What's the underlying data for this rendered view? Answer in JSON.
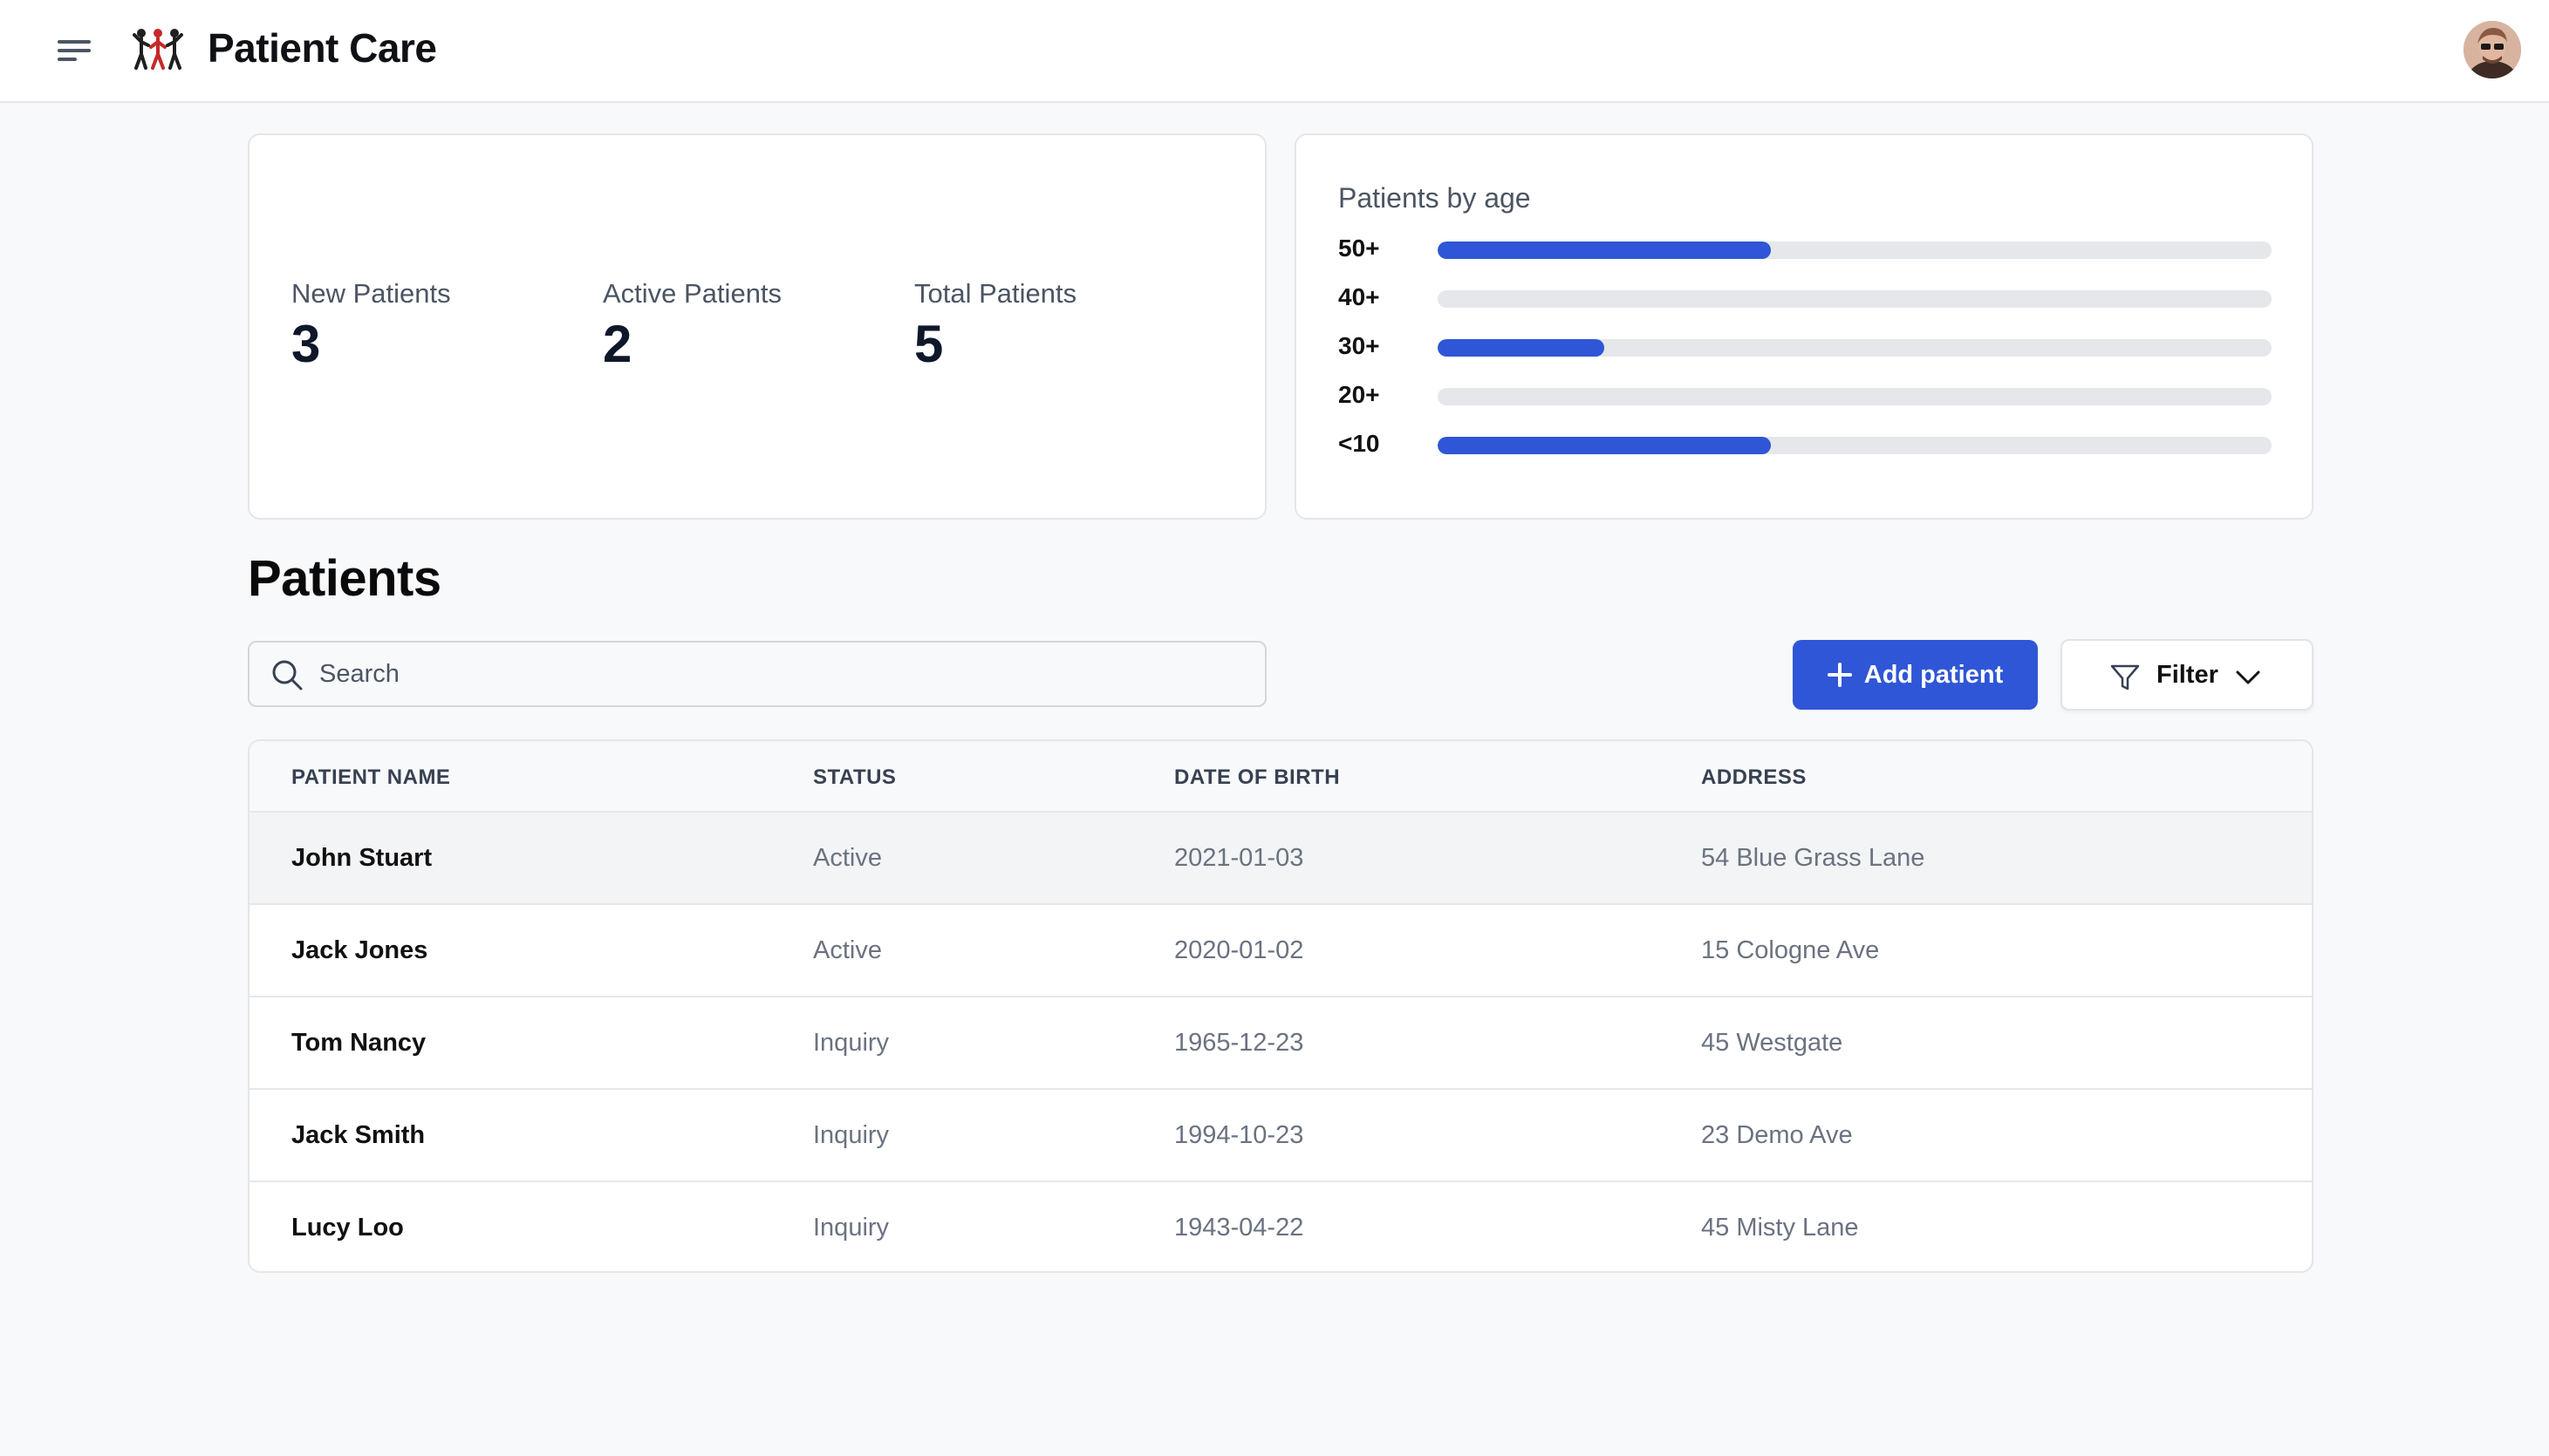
{
  "header": {
    "title": "Patient Care",
    "menu_icon": "hamburger-icon",
    "logo_icon": "people-group-icon",
    "avatar_icon": "user-avatar"
  },
  "stats": [
    {
      "label": "New Patients",
      "value": "3"
    },
    {
      "label": "Active Patients",
      "value": "2"
    },
    {
      "label": "Total Patients",
      "value": "5"
    }
  ],
  "age_chart": {
    "title": "Patients by age",
    "bars": [
      {
        "label": "50+",
        "fraction": 0.4
      },
      {
        "label": "40+",
        "fraction": 0
      },
      {
        "label": "30+",
        "fraction": 0.2
      },
      {
        "label": "20+",
        "fraction": 0
      },
      {
        "label": "<10",
        "fraction": 0.4
      }
    ],
    "fill_color": "#2f56d6",
    "track_color": "#e5e7eb"
  },
  "patients_section": {
    "title": "Patients",
    "search_placeholder": "Search",
    "add_button_label": "Add patient",
    "filter_label": "Filter"
  },
  "table": {
    "columns": [
      "PATIENT NAME",
      "STATUS",
      "DATE OF BIRTH",
      "ADDRESS"
    ],
    "rows": [
      {
        "name": "John Stuart",
        "status": "Active",
        "dob": "2021-01-03",
        "address": "54 Blue Grass Lane"
      },
      {
        "name": "Jack Jones",
        "status": "Active",
        "dob": "2020-01-02",
        "address": "15 Cologne Ave"
      },
      {
        "name": "Tom Nancy",
        "status": "Inquiry",
        "dob": "1965-12-23",
        "address": "45 Westgate"
      },
      {
        "name": "Jack Smith",
        "status": "Inquiry",
        "dob": "1994-10-23",
        "address": "23 Demo Ave"
      },
      {
        "name": "Lucy Loo",
        "status": "Inquiry",
        "dob": "1943-04-22",
        "address": "45 Misty Lane"
      }
    ]
  },
  "colors": {
    "accent": "#2f56d6",
    "background": "#f8f9fb"
  }
}
